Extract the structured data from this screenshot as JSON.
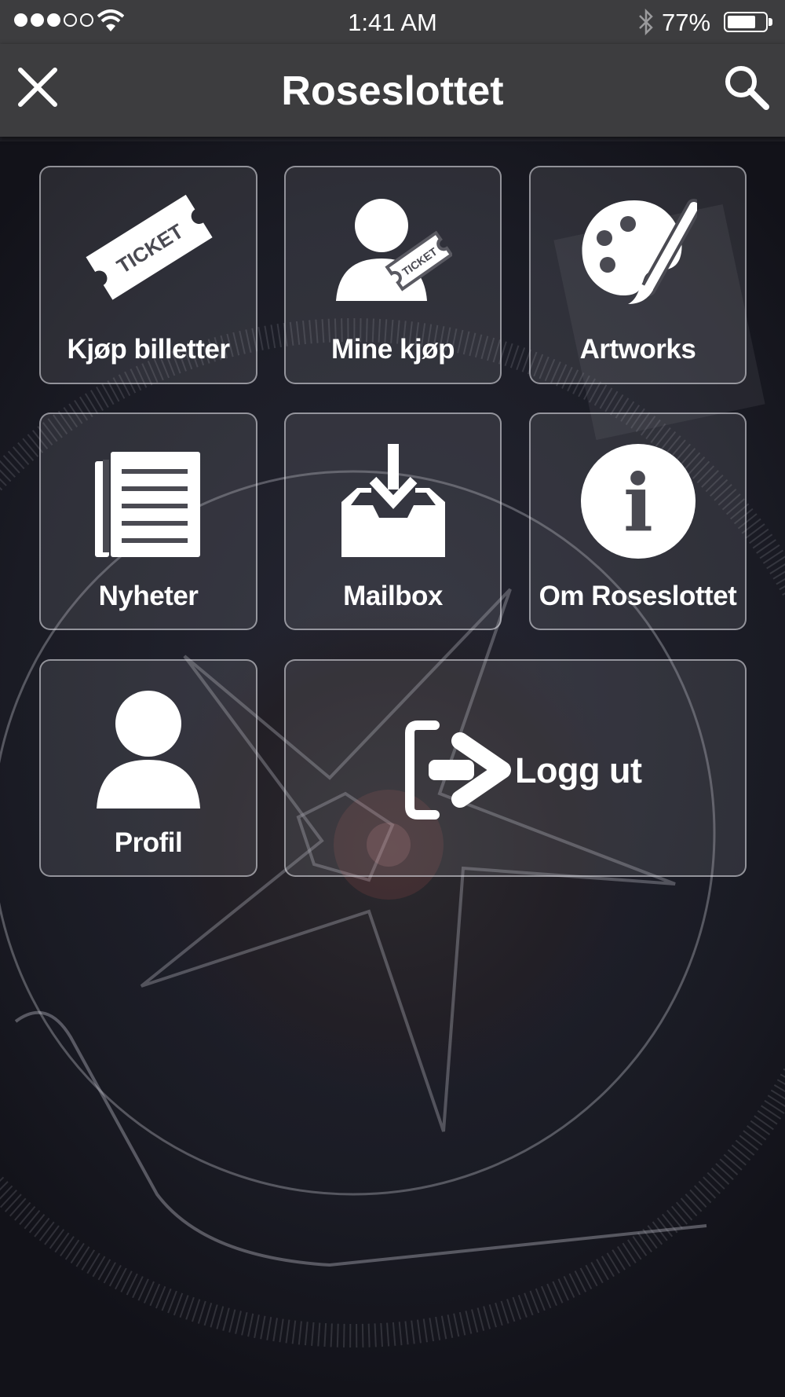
{
  "status_bar": {
    "time": "1:41 AM",
    "battery_percent": "77%",
    "battery_level": 0.77,
    "signal_bars_filled": 3,
    "signal_bars_total": 5
  },
  "nav": {
    "title": "Roseslottet",
    "close_icon": "close-icon",
    "search_icon": "search-icon"
  },
  "tiles": [
    {
      "label": "Kjøp billetter",
      "icon": "ticket-icon",
      "icon_text": "TICKET"
    },
    {
      "label": "Mine kjøp",
      "icon": "user-ticket-icon",
      "icon_text": "TICKET"
    },
    {
      "label": "Artworks",
      "icon": "palette-icon"
    },
    {
      "label": "Nyheter",
      "icon": "newspaper-icon"
    },
    {
      "label": "Mailbox",
      "icon": "inbox-download-icon"
    },
    {
      "label": "Om Roseslottet",
      "icon": "info-icon",
      "icon_text": "i"
    },
    {
      "label": "Profil",
      "icon": "user-icon"
    },
    {
      "label": "Logg ut",
      "icon": "logout-icon"
    }
  ],
  "colors": {
    "bar_background": "#3d3d3f",
    "tile_border": "#e6e6eb",
    "text": "#ffffff"
  }
}
